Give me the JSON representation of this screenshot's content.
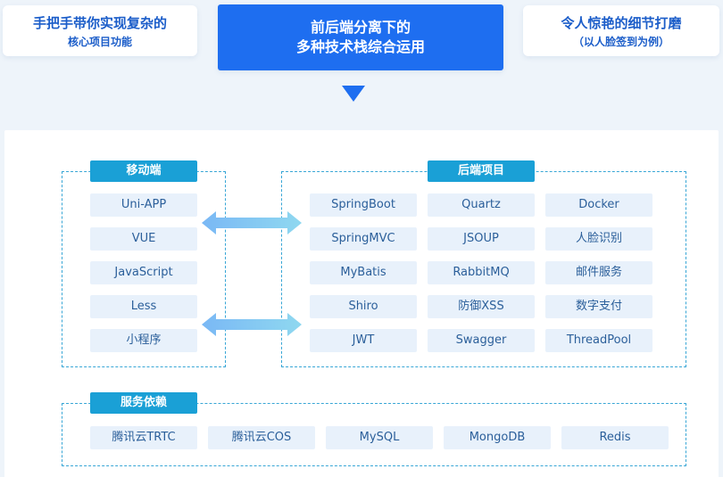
{
  "header": {
    "left_card": {
      "line1": "手把手带你实现复杂的",
      "line2": "核心项目功能"
    },
    "center_card": {
      "line1": "前后端分离下的",
      "line2": "多种技术栈综合运用"
    },
    "right_card": {
      "line1": "令人惊艳的细节打磨",
      "line2": "（以人脸签到为例）"
    }
  },
  "mobile": {
    "title": "移动端",
    "items": [
      "Uni-APP",
      "VUE",
      "JavaScript",
      "Less",
      "小程序"
    ]
  },
  "backend": {
    "title": "后端项目",
    "items": [
      "SpringBoot",
      "Quartz",
      "Docker",
      "SpringMVC",
      "JSOUP",
      "人脸识别",
      "MyBatis",
      "RabbitMQ",
      "邮件服务",
      "Shiro",
      "防御XSS",
      "数字支付",
      "JWT",
      "Swagger",
      "ThreadPool"
    ]
  },
  "services": {
    "title": "服务依赖",
    "items": [
      "腾讯云TRTC",
      "腾讯云COS",
      "MySQL",
      "MongoDB",
      "Redis"
    ]
  },
  "colors": {
    "primary": "#1e6ef0",
    "group_title": "#1aa0d6",
    "chip_bg": "#e8f1fb",
    "chip_text": "#2b5f9a",
    "dashed_border": "#38a6d6"
  }
}
